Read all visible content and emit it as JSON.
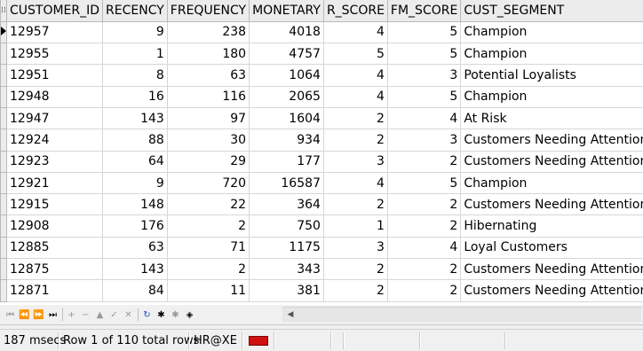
{
  "grid": {
    "header_indicator": "⁞⁞",
    "columns": [
      "CUSTOMER_ID",
      "RECENCY",
      "FREQUENCY",
      "MONETARY",
      "R_SCORE",
      "FM_SCORE",
      "CUST_SEGMENT"
    ],
    "rows": [
      [
        "12957",
        "9",
        "238",
        "4018",
        "4",
        "5",
        "Champion"
      ],
      [
        "12955",
        "1",
        "180",
        "4757",
        "5",
        "5",
        "Champion"
      ],
      [
        "12951",
        "8",
        "63",
        "1064",
        "4",
        "3",
        "Potential Loyalists"
      ],
      [
        "12948",
        "16",
        "116",
        "2065",
        "4",
        "5",
        "Champion"
      ],
      [
        "12947",
        "143",
        "97",
        "1604",
        "2",
        "4",
        "At Risk"
      ],
      [
        "12924",
        "88",
        "30",
        "934",
        "2",
        "3",
        "Customers Needing Attention"
      ],
      [
        "12923",
        "64",
        "29",
        "177",
        "3",
        "2",
        "Customers Needing Attention"
      ],
      [
        "12921",
        "9",
        "720",
        "16587",
        "4",
        "5",
        "Champion"
      ],
      [
        "12915",
        "148",
        "22",
        "364",
        "2",
        "2",
        "Customers Needing Attention"
      ],
      [
        "12908",
        "176",
        "2",
        "750",
        "1",
        "2",
        "Hibernating"
      ],
      [
        "12885",
        "63",
        "71",
        "1175",
        "3",
        "4",
        "Loyal Customers"
      ],
      [
        "12875",
        "143",
        "2",
        "343",
        "2",
        "2",
        "Customers Needing Attention"
      ],
      [
        "12871",
        "84",
        "11",
        "381",
        "2",
        "2",
        "Customers Needing Attention"
      ]
    ]
  },
  "navigator": {
    "buttons": [
      {
        "name": "first-record",
        "glyph": "⏮",
        "enabled": false
      },
      {
        "name": "prior-page",
        "glyph": "⏪",
        "enabled": false
      },
      {
        "name": "next-page",
        "glyph": "⏩",
        "enabled": true
      },
      {
        "name": "last-record",
        "glyph": "⏭",
        "enabled": true
      },
      {
        "name": "insert-record",
        "glyph": "+",
        "enabled": false
      },
      {
        "name": "delete-record",
        "glyph": "−",
        "enabled": false
      },
      {
        "name": "edit-record",
        "glyph": "▲",
        "enabled": false
      },
      {
        "name": "post-edit",
        "glyph": "✓",
        "enabled": false
      },
      {
        "name": "cancel-edit",
        "glyph": "✕",
        "enabled": false
      },
      {
        "name": "refresh",
        "glyph": "↻",
        "enabled": true,
        "blue": true
      },
      {
        "name": "query-by-example",
        "glyph": "✱",
        "enabled": true
      },
      {
        "name": "clear-query",
        "glyph": "✱",
        "enabled": false
      },
      {
        "name": "fetch-all",
        "glyph": "◈",
        "enabled": true
      }
    ],
    "scroll_left_glyph": "◀"
  },
  "status": {
    "elapsed": "187 msecs",
    "rows": "Row 1 of 110 total rows",
    "connection": "HR@XE"
  },
  "colors": {
    "connection_flag": "#d11010"
  }
}
